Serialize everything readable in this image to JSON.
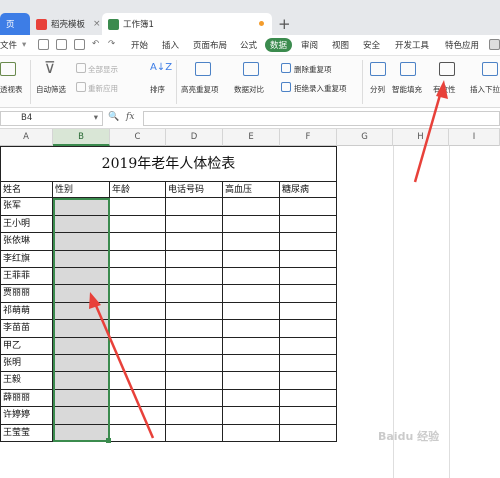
{
  "tabs": {
    "home": "页",
    "daoke": "稻壳模板",
    "workbook": "工作簿1",
    "close_glyph": "×",
    "new_tab_glyph": "+"
  },
  "menubar": {
    "file": "文件",
    "items": [
      "开始",
      "插入",
      "页面布局",
      "公式",
      "数据",
      "审阅",
      "视图",
      "安全",
      "开发工具",
      "特色应用"
    ],
    "active_index": 4,
    "active_color": "#3b8b4e"
  },
  "ribbon": {
    "pivot": "透视表",
    "autofilter": "自动筛选",
    "show_all": "全部显示",
    "reapply": "重新应用",
    "sort": "排序",
    "highlight_dup": "高亮重复项",
    "remove_dup": "删除重复项",
    "reject_dup": "拒绝录入重复项",
    "data_compare": "数据对比",
    "split": "分列",
    "smart_fill": "智能填充",
    "validity": "有效性",
    "insert_dropdown": "插入下拉"
  },
  "formula_bar": {
    "name_box": "B4",
    "fx": "fx",
    "value": ""
  },
  "columns": [
    "A",
    "B",
    "C",
    "D",
    "E",
    "F",
    "G",
    "H",
    "I"
  ],
  "selected_column": "B",
  "sheet": {
    "title": "2019年老年人体检表",
    "headers": [
      "姓名",
      "性别",
      "年龄",
      "电话号码",
      "高血压",
      "糖尿病"
    ],
    "names": [
      "张军",
      "王小明",
      "张依琳",
      "李红旗",
      "王菲菲",
      "贾丽丽",
      "祁萌萌",
      "李苗苗",
      "甲乙",
      "张明",
      "王毅",
      "薛丽丽",
      "许婷婷",
      "王莹莹"
    ]
  },
  "watermark": "Baidu 经验",
  "colors": {
    "accent": "#3b8b4e",
    "tab_blue": "#3d7de6",
    "arrow": "#e8413a",
    "selection_fill": "#d9d9d9"
  }
}
